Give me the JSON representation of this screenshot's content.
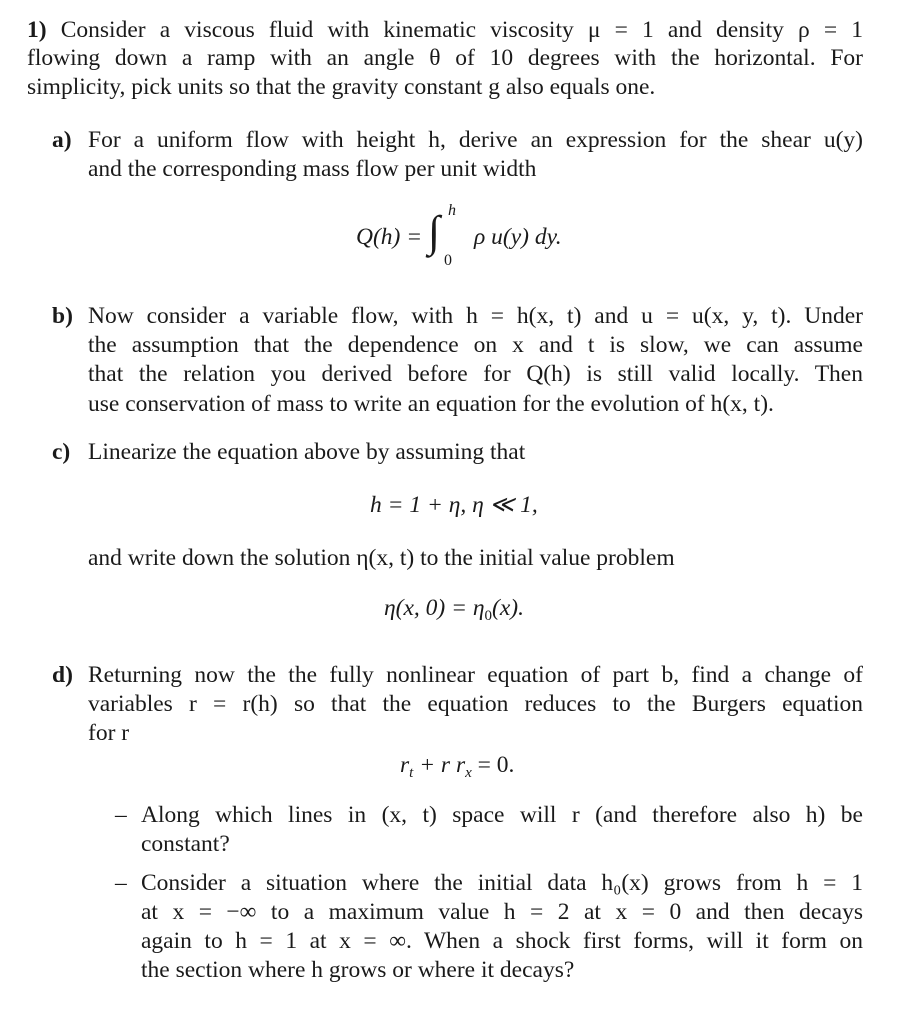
{
  "problem": {
    "number": "1)",
    "intro_lines": [
      "Consider a viscous fluid with kinematic viscosity μ = 1 and density ρ = 1",
      "flowing down a ramp with an angle θ of 10 degrees with the horizontal.  For",
      "simplicity, pick units so that the gravity constant g also equals one."
    ]
  },
  "parts": {
    "a": {
      "label": "a)",
      "lines": [
        "For a uniform flow with height h, derive an expression for the shear u(y)",
        "and the corresponding mass flow per unit width"
      ],
      "equation": {
        "lhs": "Q(h) =",
        "integral": "∫",
        "upper": "h",
        "lower": "0",
        "rhs": "ρ u(y) dy."
      }
    },
    "b": {
      "label": "b)",
      "lines": [
        "Now consider a variable flow, with h = h(x, t) and u = u(x, y, t).  Under",
        "the assumption that the dependence on x and t is slow, we can assume",
        "that the relation you derived before for Q(h) is still valid locally.  Then",
        "use conservation of mass to write an equation for the evolution of h(x, t)."
      ]
    },
    "c": {
      "label": "c)",
      "line1": "Linearize the equation above by assuming that",
      "equation1": "h = 1 + η,    η ≪ 1,",
      "line2": "and write down the solution η(x, t) to the initial value problem",
      "equation2_main": "η(x, 0) = η",
      "equation2_sub": "0",
      "equation2_tail": "(x)."
    },
    "d": {
      "label": "d)",
      "lines": [
        "Returning now the the fully nonlinear equation of part b, find a change of",
        "variables r = r(h) so that the equation reduces to the Burgers equation",
        "for r"
      ],
      "equation": {
        "r1": "r",
        "sub_t": "t",
        "mid": " + r r",
        "sub_x": "x",
        "tail": " = 0."
      },
      "bullets": [
        {
          "dash": "–",
          "lines": [
            "Along which lines in (x, t) space will r (and therefore also h) be",
            "constant?"
          ]
        },
        {
          "dash": "–",
          "lines": [
            "Consider a situation where the initial data h₀(x) grows from h = 1",
            "at x = −∞ to a maximum value h = 2 at x = 0 and then decays",
            "again to h = 1 at x = ∞. When a shock first forms, will it form on",
            "the section where h grows or where it decays?"
          ]
        }
      ]
    }
  }
}
